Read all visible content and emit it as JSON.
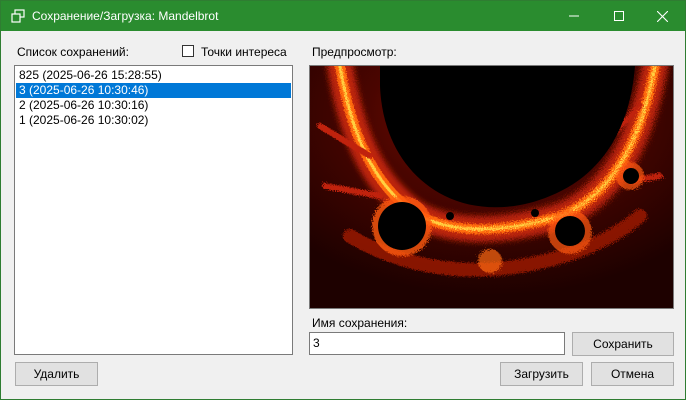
{
  "window": {
    "title": "Сохранение/Загрузка: Mandelbrot",
    "titlebar_color": "#2a8c2f",
    "icons": [
      "app-icon",
      "minimize-icon",
      "maximize-icon",
      "close-icon"
    ]
  },
  "saves": {
    "label": "Список сохранений:",
    "items": [
      "825 (2025-06-26 15:28:55)",
      "3 (2025-06-26 10:30:46)",
      "2 (2025-06-26 10:30:16)",
      "1 (2025-06-26 10:30:02)"
    ],
    "selected_index": 1,
    "selection_color": "#0078d7"
  },
  "poi": {
    "label": "Точки интереса",
    "checked": false
  },
  "preview": {
    "label": "Предпросмотр:"
  },
  "save_name": {
    "label": "Имя сохранения:",
    "value": "3"
  },
  "buttons": {
    "save": "Сохранить",
    "delete": "Удалить",
    "load": "Загрузить",
    "cancel": "Отмена"
  }
}
